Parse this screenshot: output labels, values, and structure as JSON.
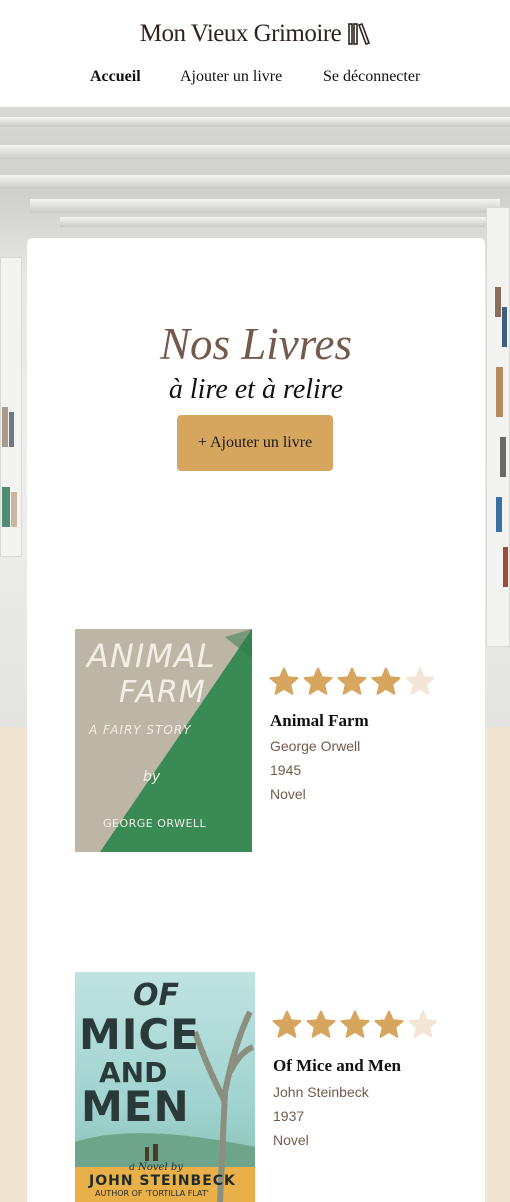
{
  "header": {
    "logo_text": "Mon Vieux Grimoire",
    "nav": [
      {
        "label": "Accueil",
        "active": true
      },
      {
        "label": "Ajouter un livre",
        "active": false
      },
      {
        "label": "Se déconnecter",
        "active": false
      }
    ]
  },
  "main": {
    "title": "Nos Livres",
    "subtitle": "à lire et à relire",
    "add_button": "+ Ajouter un livre"
  },
  "books": [
    {
      "title": "Animal Farm",
      "author": "George Orwell",
      "year": "1945",
      "genre": "Novel",
      "rating": 4,
      "max_rating": 5,
      "cover": {
        "line1": "ANIMAL",
        "line2": "FARM",
        "line3": "A FAIRY STORY",
        "line4": "by",
        "line5": "GEORGE ORWELL"
      }
    },
    {
      "title": "Of Mice and Men",
      "author": "John Steinbeck",
      "year": "1937",
      "genre": "Novel",
      "rating": 4,
      "max_rating": 5,
      "cover": {
        "line1": "OF",
        "line2": "MICE",
        "line3": "AND",
        "line4": "MEN",
        "line5": "a Novel by",
        "line6": "JOHN STEINBECK",
        "line7": "AUTHOR OF 'TORTILLA FLAT'"
      }
    }
  ],
  "colors": {
    "accent": "#d6a55e",
    "brown": "#735a4d",
    "cream": "#f1e4d1",
    "star_empty": "#f3e6d6"
  }
}
